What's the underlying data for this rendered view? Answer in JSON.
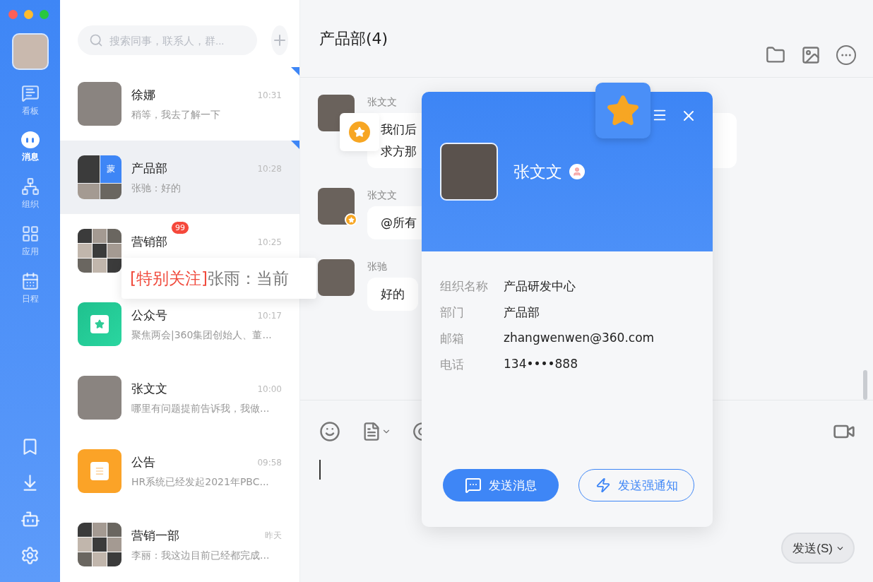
{
  "sidebar": {
    "items": [
      {
        "label": "看板",
        "selected": false
      },
      {
        "label": "消息",
        "selected": true
      },
      {
        "label": "组织",
        "selected": false
      },
      {
        "label": "应用",
        "selected": false
      },
      {
        "label": "日程",
        "selected": false
      }
    ]
  },
  "search": {
    "placeholder": "搜索同事，联系人，群..."
  },
  "conversations": [
    {
      "name": "徐娜",
      "time": "10:31",
      "preview": "稍等，我去了解一下",
      "kind": "photo",
      "pinned": true,
      "selected": false
    },
    {
      "name": "产品部",
      "time": "10:28",
      "preview": "张驰：好的",
      "kind": "group4",
      "group_tag": "蒙",
      "pinned": true,
      "selected": true
    },
    {
      "name": "营销部",
      "time": "10:25",
      "kind": "group9",
      "badge": "99",
      "pinned": false,
      "selected": false
    },
    {
      "name": "公众号",
      "time": "10:17",
      "preview": "聚焦两会|360集团创始人、董...",
      "kind": "app-green",
      "pinned": false,
      "selected": false
    },
    {
      "name": "张文文",
      "time": "10:00",
      "preview": "哪里有问题提前告诉我，我做...",
      "kind": "photo",
      "pinned": false,
      "selected": false
    },
    {
      "name": "公告",
      "time": "09:58",
      "preview": "HR系统已经发起2021年PBC...",
      "kind": "app-orange",
      "pinned": false,
      "selected": false
    },
    {
      "name": "营销一部",
      "time": "昨天",
      "preview": "李丽：我这边目前已经都完成...",
      "kind": "group9",
      "pinned": false,
      "selected": false
    }
  ],
  "preview_tooltip": {
    "tag": "[特别关注]",
    "text": "张雨：当前"
  },
  "chat": {
    "title": "产品部(4)",
    "messages": [
      {
        "sender": "张文文",
        "lines": [
          "我们后",
          "求方那"
        ],
        "starred": false
      },
      {
        "sender": "张文文",
        "lines": [
          "@所有"
        ],
        "starred": true
      },
      {
        "sender": "张驰",
        "lines": [
          "好的"
        ],
        "starred": false
      }
    ],
    "send_button": "发送(S)"
  },
  "profile_card": {
    "name": "张文文",
    "fields": [
      {
        "label": "组织名称",
        "value": "产品研发中心"
      },
      {
        "label": "部门",
        "value": "产品部"
      },
      {
        "label": "邮箱",
        "value": "zhangwenwen@360.com"
      },
      {
        "label": "电话",
        "value": "134••••888"
      }
    ],
    "buttons": [
      {
        "label": "发送消息",
        "kind": "primary"
      },
      {
        "label": "发送强通知",
        "kind": "outline"
      }
    ]
  }
}
